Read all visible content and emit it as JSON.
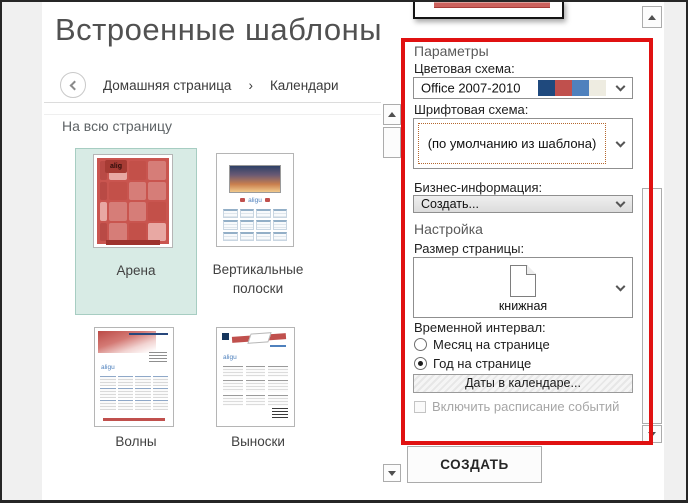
{
  "page": {
    "title": "Встроенные шаблоны"
  },
  "breadcrumb": {
    "home": "Домашняя страница",
    "separator": "›",
    "current": "Календари"
  },
  "gallery": {
    "section_label": "На всю страницу",
    "templates": [
      {
        "name": "Арена",
        "selected": true,
        "thumb_text": "alig"
      },
      {
        "name": "Вертикальные полоски",
        "selected": false,
        "thumb_text": "aligu"
      },
      {
        "name": "Волны",
        "selected": false,
        "thumb_text": "aligu"
      },
      {
        "name": "Выноски",
        "selected": false,
        "thumb_text": "aligu"
      }
    ]
  },
  "options_panel": {
    "header": "Параметры",
    "color_scheme": {
      "label": "Цветовая схема:",
      "value": "Office 2007-2010",
      "swatches": [
        "#1f497d",
        "#c0504d",
        "#4f81bd",
        "#eeece1"
      ]
    },
    "font_scheme": {
      "label": "Шрифтовая схема:",
      "value": "(по умолчанию из шаблона)"
    },
    "business_info": {
      "label": "Бизнес-информация:",
      "value": "Создать..."
    },
    "customize_header": "Настройка",
    "page_size": {
      "label": "Размер страницы:",
      "value": "книжная"
    },
    "time_interval": {
      "label": "Временной интервал:",
      "options": [
        {
          "label": "Месяц на странице",
          "selected": false
        },
        {
          "label": "Год на странице",
          "selected": true
        }
      ]
    },
    "calendar_dates_button": "Даты в календаре...",
    "include_events_checkbox": {
      "label": "Включить расписание событий",
      "checked": false,
      "disabled": true
    }
  },
  "create_button": "СОЗДАТЬ",
  "colors": {
    "annotation": "#e01111",
    "selection_bg": "#d8ebe5",
    "selection_border": "#a7cdc2",
    "accent_red": "#c0504d"
  }
}
